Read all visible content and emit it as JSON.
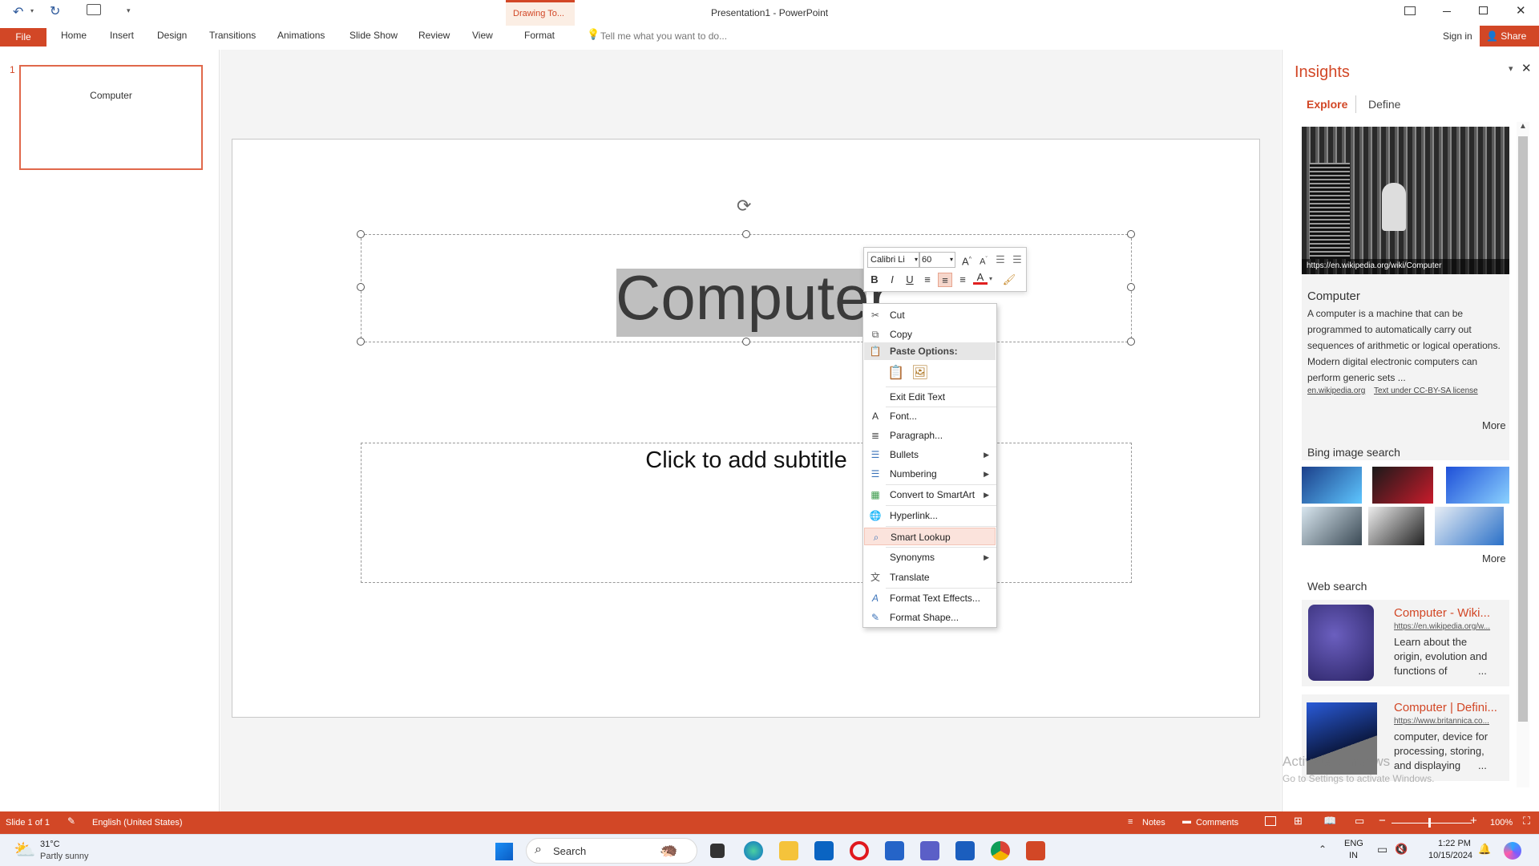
{
  "window": {
    "title": "Presentation1 - PowerPoint",
    "context_tab_group": "Drawing To...",
    "sign_in": "Sign in",
    "share": "Share"
  },
  "ribbon": {
    "tabs": [
      "File",
      "Home",
      "Insert",
      "Design",
      "Transitions",
      "Animations",
      "Slide Show",
      "Review",
      "View",
      "Format"
    ],
    "tell_me": "Tell me what you want to do..."
  },
  "thumbnails": {
    "number": "1",
    "title": "Computer"
  },
  "slide": {
    "title": "Computer",
    "subtitle_placeholder": "Click to add subtitle"
  },
  "mini_toolbar": {
    "font": "Calibri Li",
    "size": "60",
    "bold": "B",
    "italic": "I",
    "underline": "U",
    "font_color": "A",
    "accent_color": "#e02020"
  },
  "context_menu": {
    "cut": "Cut",
    "copy": "Copy",
    "paste_options": "Paste Options:",
    "exit_edit": "Exit Edit Text",
    "font": "Font...",
    "paragraph": "Paragraph...",
    "bullets": "Bullets",
    "numbering": "Numbering",
    "smartart": "Convert to SmartArt",
    "hyperlink": "Hyperlink...",
    "smart_lookup": "Smart Lookup",
    "synonyms": "Synonyms",
    "translate": "Translate",
    "text_effects": "Format Text Effects...",
    "format_shape": "Format Shape..."
  },
  "insights": {
    "title": "Insights",
    "tab_explore": "Explore",
    "tab_define": "Define",
    "image_caption": "https://en.wikipedia.org/wiki/Computer",
    "card_title": "Computer",
    "card_text": "A computer is a machine that can be programmed to automatically carry out sequences of arithmetic or logical operations. Modern digital electronic computers can perform generic sets ...",
    "source": "en.wikipedia.org",
    "license": "Text under CC-BY-SA license",
    "more1": "More",
    "bing_heading": "Bing image search",
    "more2": "More",
    "web_heading": "Web search",
    "web1_title": "Computer - Wiki...",
    "web1_url": "https://en.wikipedia.org/w...",
    "web1_desc": "Learn about the origin, evolution and functions of",
    "web1_ellipsis": "...",
    "web2_title": "Computer | Defini...",
    "web2_url": "https://www.britannica.co...",
    "web2_desc": "computer, device for processing, storing, and displaying",
    "web2_ellipsis": "...",
    "watermark1": "Activate Windows",
    "watermark2": "Go to Settings to activate Windows."
  },
  "status": {
    "slide": "Slide 1 of 1",
    "language": "English (United States)",
    "notes": "Notes",
    "comments": "Comments",
    "zoom": "100%"
  },
  "taskbar": {
    "temp": "31°C",
    "weather": "Partly sunny",
    "search": "Search",
    "lang1": "ENG",
    "lang2": "IN",
    "time": "1:22 PM",
    "date": "10/15/2024"
  }
}
